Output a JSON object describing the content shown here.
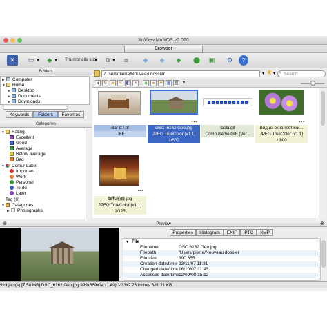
{
  "window": {
    "title": "XnView MultiOS v0.020",
    "tab": "Browser"
  },
  "toolbar": {
    "thumbnails_label": "Thumbnails size"
  },
  "pathbar": {
    "path": "/Users/pierre/Nouveau dossier",
    "search_placeholder": "Search"
  },
  "folders": {
    "header": "Folders",
    "items": [
      "Computer",
      "Home",
      "Desktop",
      "Documents",
      "Downloads"
    ],
    "tabs": [
      "Keywords",
      "Folders",
      "Favorites"
    ]
  },
  "categories": {
    "header": "Categories",
    "rating_label": "Rating",
    "ratings": [
      "Excellent",
      "Good",
      "Average",
      "Below average",
      "Bad"
    ],
    "rating_colors": [
      "#8e3fb0",
      "#3b58c8",
      "#3e9b3e",
      "#d7c53a",
      "#e07f2a"
    ],
    "colour_label": "Colour Label",
    "colours": [
      "Important",
      "Work",
      "Personal",
      "To do",
      "Later"
    ],
    "colour_colors": [
      "#d62d2d",
      "#e07f2a",
      "#3e9b3e",
      "#3b58c8",
      "#8e3fb0"
    ],
    "tag": "Tag (0)",
    "categories_label": "Categories",
    "subcategory": "Photographs"
  },
  "files": [
    {
      "name": "Bar CT.tif",
      "format": "TIFF",
      "extra": "",
      "selected": "light"
    },
    {
      "name": "DSC_6162 Geo.jpg",
      "format": "JPEG TrueColor (v1.1)",
      "extra": "1/500",
      "selected": "dark"
    },
    {
      "name": "laola.gif",
      "format": "Compuserve GIF (Ver...",
      "extra": "",
      "selected": "light"
    },
    {
      "name": "Вид из окна гостини...",
      "format": "JPEG TrueColor (v1.1)",
      "extra": "1/800",
      "selected": "light"
    },
    {
      "name": "頤和前頁.jpg",
      "format": "JPEG TrueColor (v1.1)",
      "extra": "1/125",
      "selected": "none"
    }
  ],
  "preview": {
    "header": "Preview",
    "tabs": [
      "Properties",
      "Histogram",
      "EXIF",
      "IPTC",
      "XMP"
    ],
    "section": "File",
    "rows": [
      {
        "key": "Filename",
        "value": "DSC 6162 Geo.jpg"
      },
      {
        "key": "Filepath",
        "value": "/Users/pierre/Nouveau dossier"
      },
      {
        "key": "File size",
        "value": "390 355"
      },
      {
        "key": "Creation date/time",
        "value": "23/11/07 11:31"
      },
      {
        "key": "Changed date/time",
        "value": "16/10/07 11:43"
      },
      {
        "key": "Accessed date/time",
        "value": "12/09/08 15:12"
      }
    ]
  },
  "status": "9 object(s) [7.58 MB]  DSC_6162 Geo.jpg  999x669x24 (1.49)  3.33x2.23 inches  381.21 KB"
}
